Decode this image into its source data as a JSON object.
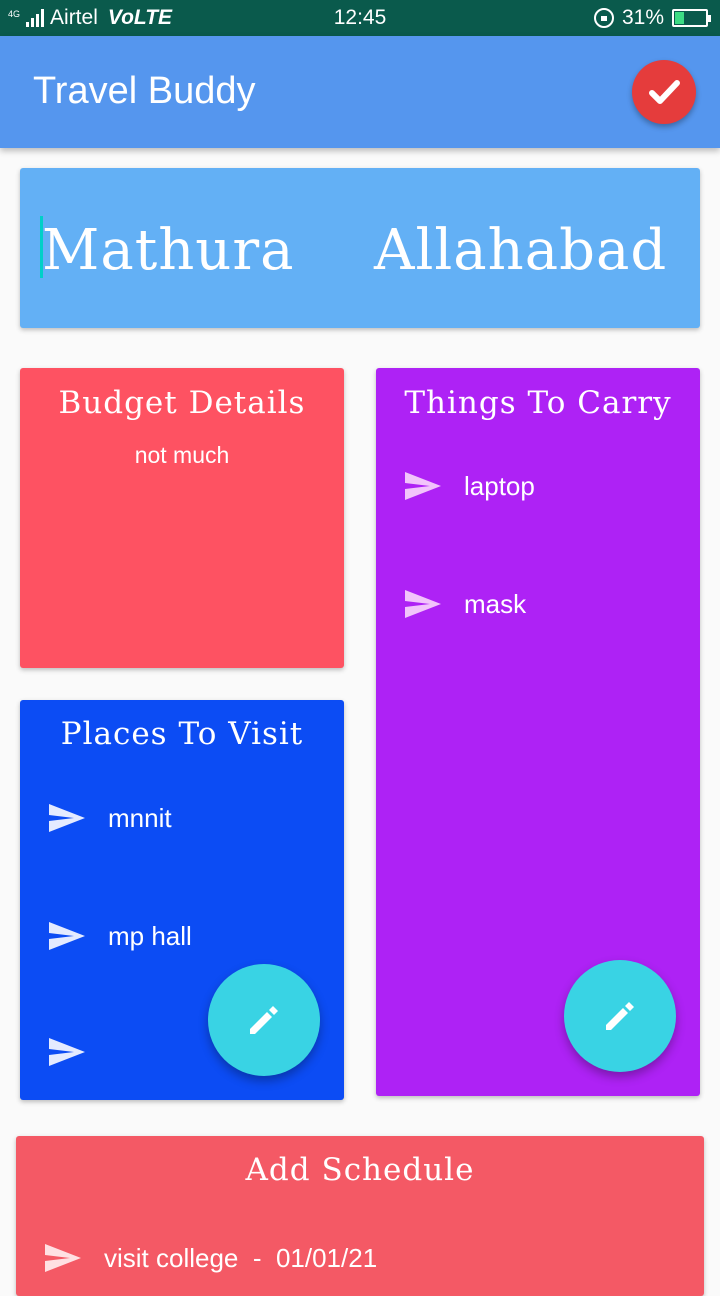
{
  "status_bar": {
    "network_tag": "4G",
    "carrier": "Airtel",
    "volte": "VoLTE",
    "time": "12:45",
    "battery": "31%",
    "battery_level": 0.31
  },
  "app_bar": {
    "title": "Travel Buddy",
    "confirm_icon": "check-icon",
    "accent_color": "#5596ee"
  },
  "route": {
    "from": "Mathura",
    "to": "Allahabad"
  },
  "budget": {
    "heading": "Budget Details",
    "text": "not much"
  },
  "things": {
    "heading": "Things To Carry",
    "items": [
      "laptop",
      "mask"
    ]
  },
  "places": {
    "heading": "Places To Visit",
    "items": [
      "mnnit",
      "mp hall",
      ""
    ]
  },
  "schedule": {
    "heading": "Add Schedule",
    "items": [
      {
        "text": "visit college  -  01/01/21"
      }
    ]
  },
  "icons": {
    "edit": "pencil-icon",
    "bullet": "send-icon"
  }
}
